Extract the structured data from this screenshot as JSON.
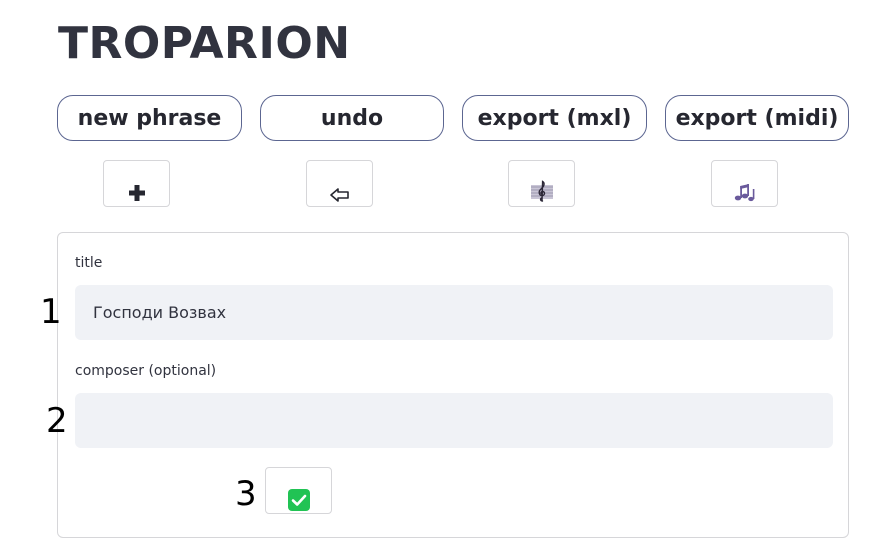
{
  "app": {
    "title": "TROPARION"
  },
  "toolbar": {
    "buttons": [
      {
        "label": "new phrase"
      },
      {
        "label": "undo"
      },
      {
        "label": "export (mxl)"
      },
      {
        "label": "export (midi)"
      }
    ],
    "icons": [
      {
        "name": "plus-icon",
        "glyph": "+"
      },
      {
        "name": "undo-arrow-icon",
        "glyph": "⇦"
      },
      {
        "name": "treble-clef-icon",
        "glyph": "𝄞"
      },
      {
        "name": "music-notes-icon",
        "glyph": "♫"
      }
    ]
  },
  "form": {
    "title_label": "title",
    "title_value": "Господи Возвах",
    "composer_label": "composer (optional)",
    "composer_value": "",
    "confirm_icon": "check-icon"
  },
  "markers": [
    "1",
    "2",
    "3"
  ],
  "colors": {
    "text": "#31333f",
    "pill_border": "#5c6691",
    "input_bg": "#f0f2f6",
    "check_green": "#21c354",
    "music_icon": "#6a5a9c"
  }
}
